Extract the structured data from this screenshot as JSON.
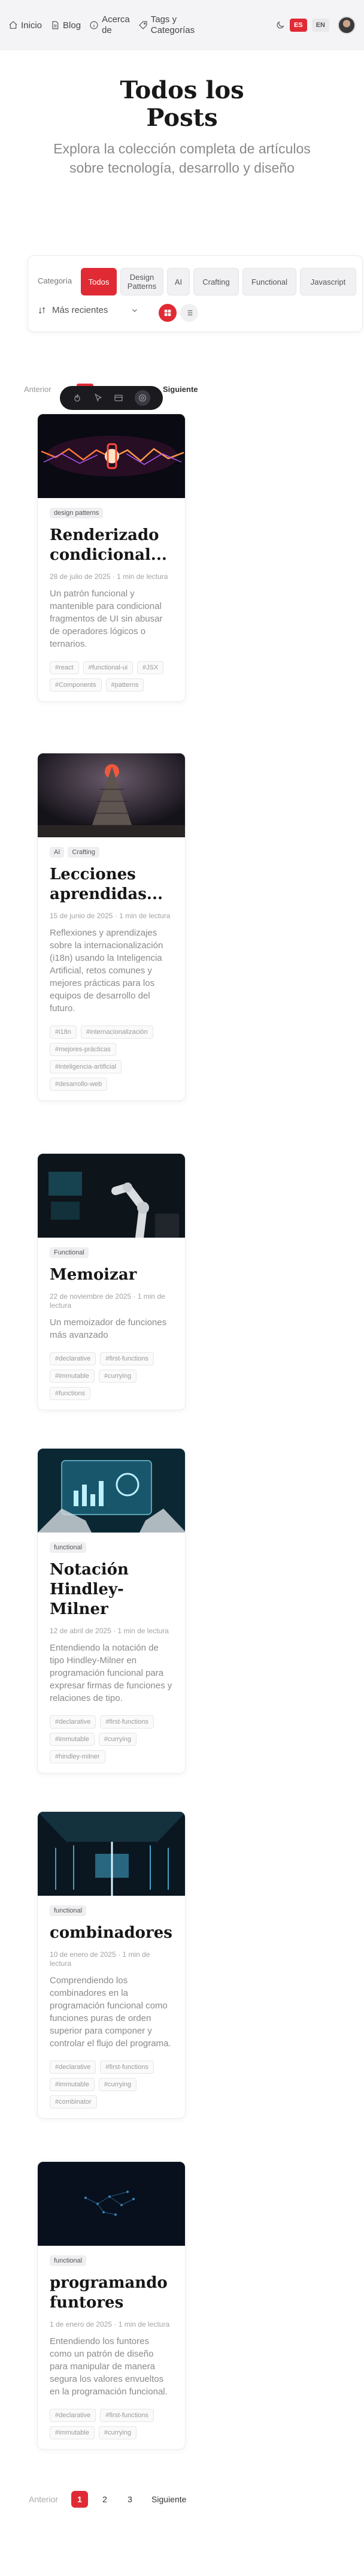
{
  "nav": {
    "home": "Inicio",
    "blog": "Blog",
    "about_line1": "Acerca",
    "about_line2": "de",
    "tags_line1": "Tags y",
    "tags_line2": "Categorías",
    "lang_es": "ES",
    "lang_en": "EN"
  },
  "hero": {
    "title_line1": "Todos los",
    "title_line2": "Posts",
    "subtitle": "Explora la colección completa de artículos sobre tecnología, desarrollo y diseño"
  },
  "filters": {
    "category_label": "Categoría",
    "chips": [
      "Todos",
      "Design Patterns",
      "AI",
      "Crafting",
      "Functional",
      "Javascript"
    ],
    "sort_label": "Más recientes"
  },
  "pagination_top": {
    "prev": "Anterior",
    "next": "Siguiente"
  },
  "posts": [
    {
      "tags": [
        "design patterns"
      ],
      "title": "Renderizado condicional...",
      "meta": "28 de julio de 2025 · 1 min de lectura",
      "excerpt": "Un patrón funcional y mantenible para condicional fragmentos de UI sin abusar de operadores lógicos o ternarios.",
      "hashtags": [
        "#react",
        "#functional-ui",
        "#JSX",
        "#Components",
        "#patterns"
      ]
    },
    {
      "tags": [
        "AI",
        "Crafting"
      ],
      "title": "Lecciones aprendidas...",
      "meta": "15 de junio de 2025 · 1 min de lectura",
      "excerpt": "Reflexiones y aprendizajes sobre la internacionalización (i18n) usando la Inteligencia Artificial, retos comunes y mejores prácticas para los equipos de desarrollo del futuro.",
      "hashtags": [
        "#i18n",
        "#internacionalización",
        "#mejores-prácticas",
        "#inteligencia-artificial",
        "#desarrollo-web"
      ]
    },
    {
      "tags": [
        "Functional"
      ],
      "title": "Memoizar",
      "meta": "22 de noviembre de 2025 · 1 min de lectura",
      "excerpt": "Un memoizador de funciones más avanzado",
      "hashtags": [
        "#declarative",
        "#first-functions",
        "#immutable",
        "#currying",
        "#functions"
      ]
    },
    {
      "tags": [
        "functional"
      ],
      "title": "Notación Hindley-Milner",
      "meta": "12 de abril de 2025 · 1 min de lectura",
      "excerpt": "Entendiendo la notación de tipo Hindley-Milner en programación funcional para expresar firmas de funciones y relaciones de tipo.",
      "hashtags": [
        "#declarative",
        "#first-functions",
        "#immutable",
        "#currying",
        "#hindley-milner"
      ]
    },
    {
      "tags": [
        "functional"
      ],
      "title": "combinadores",
      "meta": "10 de enero de 2025 · 1 min de lectura",
      "excerpt": "Comprendiendo los combinadores en la programación funcional como funciones puras de orden superior para componer y controlar el flujo del programa.",
      "hashtags": [
        "#declarative",
        "#first-functions",
        "#immutable",
        "#currying",
        "#combinator"
      ]
    },
    {
      "tags": [
        "functional"
      ],
      "title": "programando funtores",
      "meta": "1 de enero de 2025 · 1 min de lectura",
      "excerpt": "Entendiendo los funtores como un patrón de diseño para manipular de manera segura los valores envueltos en la programación funcional.",
      "hashtags": [
        "#declarative",
        "#first-functions",
        "#immutable",
        "#currying"
      ]
    }
  ],
  "pagination_bottom": {
    "prev": "Anterior",
    "pages": [
      "1",
      "2",
      "3"
    ],
    "next": "Siguiente"
  }
}
